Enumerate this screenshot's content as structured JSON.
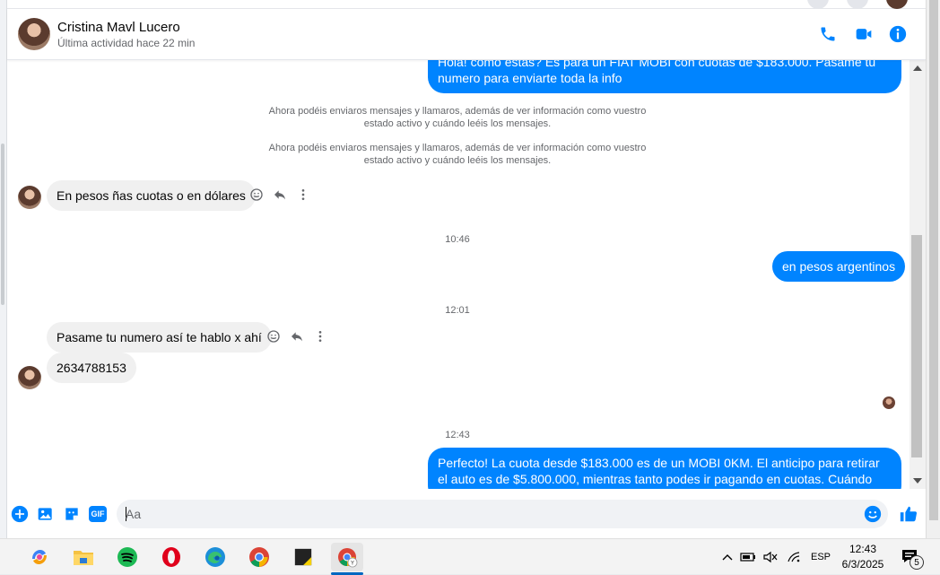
{
  "contact": {
    "name": "Cristina Mavl Lucero",
    "status": "Última actividad hace 22 min"
  },
  "colors": {
    "accent": "#0084ff",
    "bubble_in": "#f0f0f0",
    "muted_text": "#65676b"
  },
  "messages": {
    "out1": "Hola! como estas? Es para un FIAT MOBI con cuotas de $183.000. Pasame tu numero para enviarte toda la info",
    "sys1": "Ahora podéis enviaros mensajes y llamaros, además de ver información como vuestro estado activo y cuándo leéis los mensajes.",
    "sys2": "Ahora podéis enviaros mensajes y llamaros, además de ver información como vuestro estado activo y cuándo leéis los mensajes.",
    "in1": "En pesos ñas cuotas o en dólares",
    "ts1": "10:46",
    "out2": "en pesos argentinos",
    "ts2": "12:01",
    "in2": "Pasame tu numero así te hablo x ahí",
    "in3": "2634788153",
    "ts3": "12:43",
    "out3": "Perfecto! La cuota desde $183.000 es de un MOBI 0KM. El anticipo para retirar el auto es de $5.800.000, mientras tanto podes ir pagando en cuotas. Cuándo podes"
  },
  "composer": {
    "placeholder": "Aa",
    "gif_label": "GIF"
  },
  "taskbar": {
    "language": "ESP",
    "time": "12:43",
    "date": "6/3/2025",
    "notification_count": "5"
  }
}
